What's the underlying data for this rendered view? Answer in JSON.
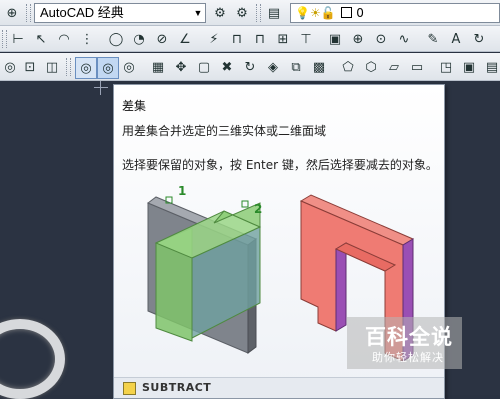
{
  "toolbar": {
    "workspace_name": "AutoCAD 经典",
    "layer_name": "0",
    "layer_icons": "💡☀🔓"
  },
  "tooltip": {
    "title": "差集",
    "description": "用差集合并选定的三维实体或二维面域",
    "instruction": "选择要保留的对象，按 Enter 键，然后选择要减去的对象。",
    "label_1": "1",
    "label_2": "2",
    "command": "SUBTRACT"
  },
  "watermark": {
    "main": "百科全说",
    "sub": "助你轻松解决"
  },
  "colors": {
    "canvas": "#2b3342",
    "solid_green": "#7fc36a",
    "solid_gray": "#8b8f96",
    "result_red": "#ef7b73",
    "result_purple": "#9a4fb4",
    "label_green": "#2a8a2a"
  }
}
